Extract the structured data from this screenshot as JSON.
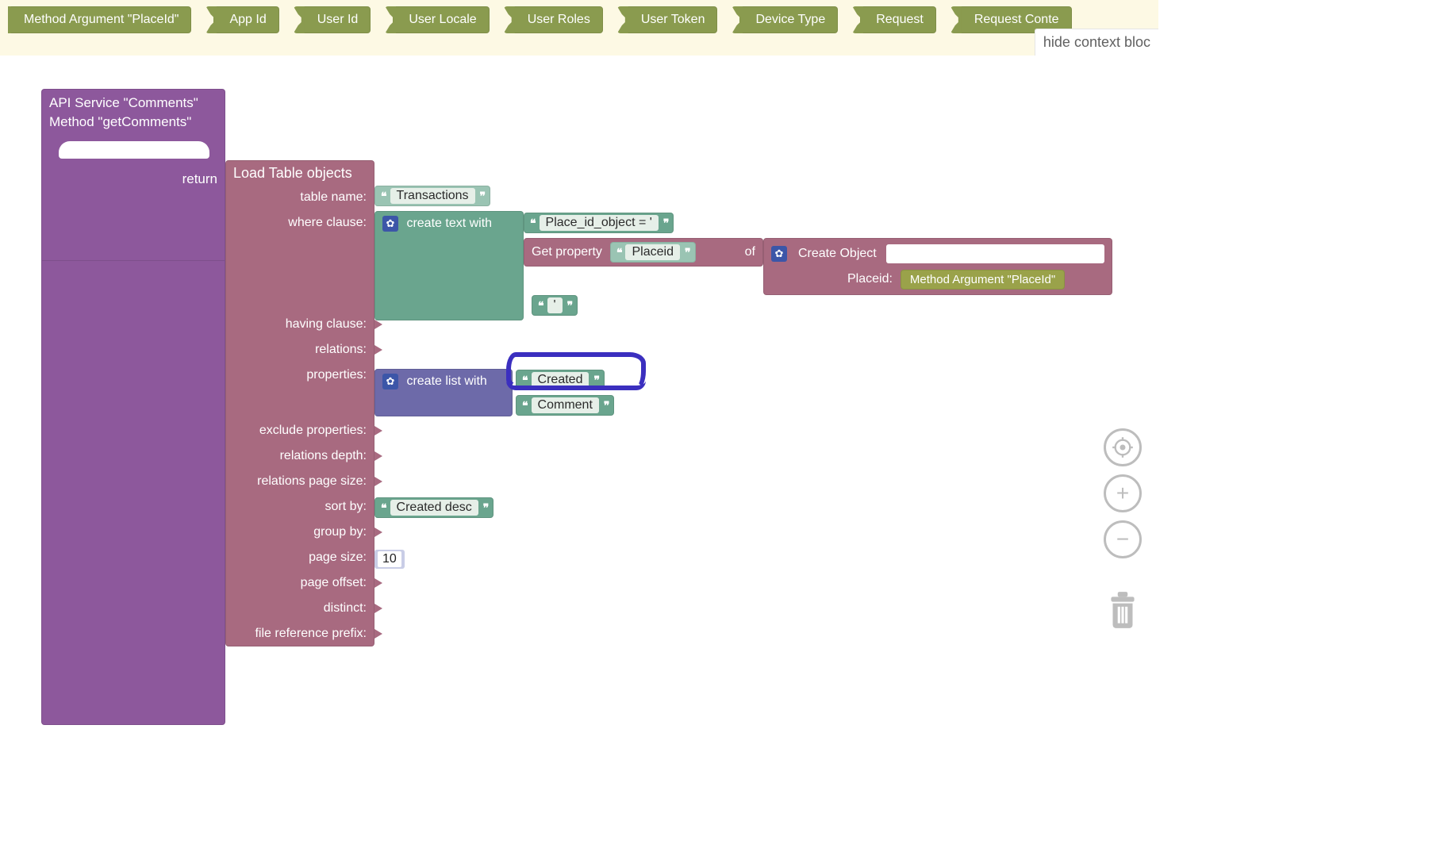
{
  "context_blocks": [
    "Method Argument \"PlaceId\"",
    "App Id",
    "User Id",
    "User Locale",
    "User Roles",
    "User Token",
    "Device Type",
    "Request",
    "Request Conte"
  ],
  "hide_link": "hide context bloc",
  "service": {
    "title": "API Service \"Comments\"",
    "method": "Method \"getComments\"",
    "return_label": "return"
  },
  "load": {
    "title": "Load Table objects",
    "rows": {
      "table_name": "table name:",
      "where_clause": "where clause:",
      "having_clause": "having clause:",
      "relations": "relations:",
      "properties": "properties:",
      "exclude_properties": "exclude properties:",
      "relations_depth": "relations depth:",
      "relations_page_size": "relations page size:",
      "sort_by": "sort by:",
      "group_by": "group by:",
      "page_size": "page size:",
      "page_offset": "page offset:",
      "distinct": "distinct:",
      "file_reference_prefix": "file reference prefix:"
    }
  },
  "values": {
    "table_name": "Transactions",
    "where_literal": "Place_id_object = '",
    "closing_quote": "'",
    "sort_by": "Created desc",
    "page_size": "10"
  },
  "create_text_with": "create text with",
  "get_property": {
    "label": "Get property",
    "prop": "Placeid",
    "of": "of"
  },
  "create_object": {
    "label": "Create Object",
    "key": "Placeid:",
    "arg": "Method Argument \"PlaceId\""
  },
  "create_list_with": "create list with",
  "list_items": {
    "created": "Created",
    "comment": "Comment"
  }
}
